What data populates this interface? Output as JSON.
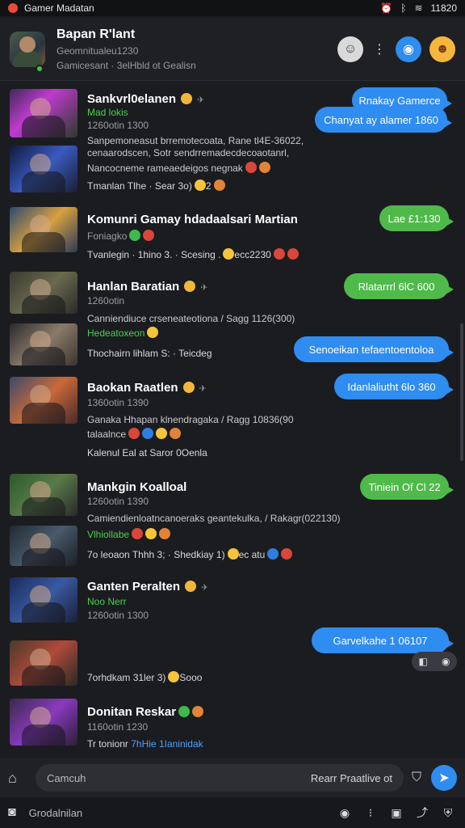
{
  "status_bar": {
    "app_name": "Gamer Madatan",
    "time": "11820"
  },
  "header": {
    "title": "Bapan R'lant",
    "subtitle_1": "Geomnitualeu1230",
    "subtitle_2": "Gamicesant · 3elHbld ot Gealisn"
  },
  "messages": [
    {
      "name": "Sankvrl0elanen",
      "meta_green": "Mad lokis",
      "meta": "1260otin 1300",
      "desc_1": "Sanpemoneasut brremotecoata, Rane tl4E-36022,",
      "desc_2": "cenaarodscen, Sotr sendrremadecdecoaotanrl,",
      "desc_3": "Nancocneme rameaedeigos negnak",
      "footer": "Tmanlan Tlhe · Sear 3o)",
      "footer_after": "2",
      "bubble_1": "Rnakay Gamerce",
      "bubble_2": "Chanyat ay alamer 1860"
    },
    {
      "name": "Komunri Gamay hdadaalsari Martian",
      "meta": "Foniagko",
      "footer": "Tvanlegin · 1hino 3. · Scesing .",
      "footer_after": "ecc2230",
      "bubble": "Lae £1:130"
    },
    {
      "name": "Hanlan Baratian",
      "meta": "1260otin",
      "desc": "Canniendiuce crseneateotiona / Sagg 1126(300)",
      "meta_green": "Hedeatoxeon",
      "footer": "Thochairn lihlam S: · Teicdeg",
      "bubble_green": "Rlatarrrl 6lC 600",
      "bubble_blue": "Senoeikan tefaentoentoloa"
    },
    {
      "name": "Baokan Raatlen",
      "meta": "1360otin 1390",
      "desc_1": "Ganaka Hhapan klnendragaka / Ragg 10836(90",
      "desc_2": "talaalnce",
      "footer": "Kalenul Eal at Saror 0Oenla",
      "bubble": "Idanlaliutht 6lo 360"
    },
    {
      "name": "Mankgin Koalloal",
      "meta": "1260otin 1390",
      "desc": "Camiendienloatncanoeraks geantekulka, / Rakagr(022130)",
      "meta_green": "Vlhiollabe",
      "footer": "7o leoaon Thhh 3; · Shedkiay 1)",
      "footer_after": "ec atu",
      "bubble": "Tiniein Of Cl 22"
    },
    {
      "name": "Ganten Peralten",
      "meta_green": "Noo Nerr",
      "meta": "1260otin 1300",
      "footer": "7orhdkam 31ler 3)",
      "footer_after": "Sooo",
      "bubble": "Garvelkahe 1 06107"
    },
    {
      "name": "Donitan Reskar",
      "meta": "1160otin 1230",
      "footer": "Tr tonionr",
      "footer_accent": "7hHie 1Ianinidak"
    }
  ],
  "composer": {
    "placeholder": "Camcuh",
    "aux": "Rearr Praatlive ot"
  },
  "bottom": {
    "label": "Grodalnilan"
  },
  "colors": {
    "accent_blue": "#2f8cf0",
    "accent_green": "#4fba4a",
    "background": "#1b1c20"
  }
}
